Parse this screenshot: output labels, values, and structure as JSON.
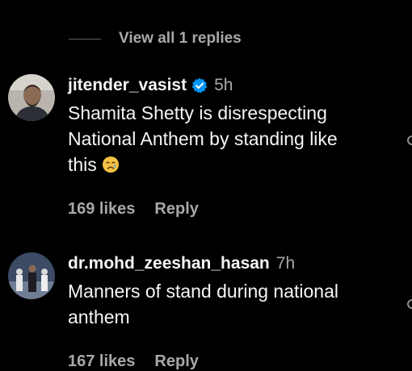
{
  "view_replies": {
    "label": "View all 1 replies"
  },
  "comments": [
    {
      "username": "jitender_vasist",
      "verified": true,
      "timestamp": "5h",
      "text_lines": [
        "Shamita Shetty is disrespecting",
        "National Anthem by standing like",
        "this"
      ],
      "emoji": "crying-face-emoji",
      "likes": "169 likes",
      "reply_label": "Reply"
    },
    {
      "username": "dr.mohd_zeeshan_hasan",
      "verified": false,
      "timestamp": "7h",
      "text_lines": [
        "Manners of stand during national",
        "anthem"
      ],
      "likes": "167 likes",
      "reply_label": "Reply"
    }
  ],
  "colors": {
    "background": "#000000",
    "primary_text": "#f5f5f5",
    "secondary_text": "#a8a8a8",
    "verified_badge": "#0095f6"
  }
}
